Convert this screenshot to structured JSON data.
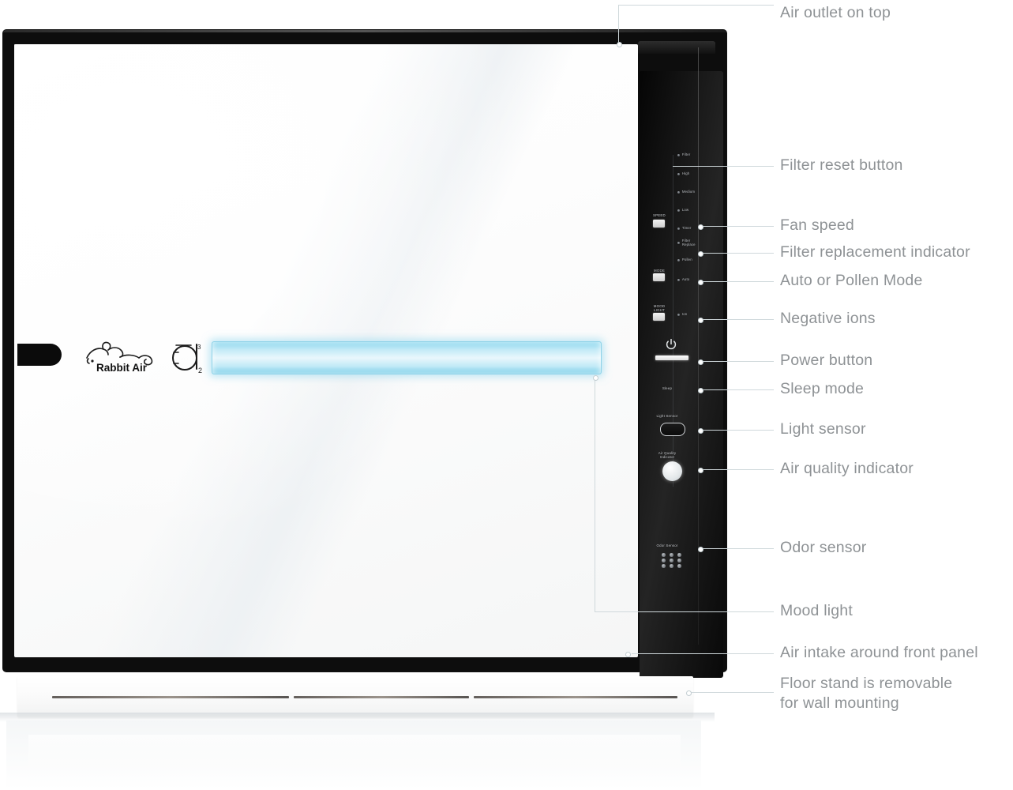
{
  "device": {
    "brand": "Rabbit Air",
    "model_logo": "A3",
    "front_panel_color": "#ffffff",
    "frame_color": "#0d0d0d",
    "mood_light_color": "#8ed2e8"
  },
  "control_panel": {
    "led_indicators": [
      {
        "name": "filter-reset-led",
        "label": "Filter"
      },
      {
        "name": "high-speed-led",
        "label": "High"
      },
      {
        "name": "medium-speed-led",
        "label": "Medium"
      },
      {
        "name": "low-speed-led",
        "label": "Low"
      },
      {
        "name": "timer-led",
        "label": "Timer"
      },
      {
        "name": "filter-replacement-led",
        "label": "Filter\nReplace"
      },
      {
        "name": "pollen-mode-led",
        "label": "Pollen"
      },
      {
        "name": "auto-mode-led",
        "label": "Auto"
      },
      {
        "name": "negative-ion-led",
        "label": "Ion"
      }
    ],
    "buttons": [
      {
        "name": "speed-button",
        "label": "SPEED"
      },
      {
        "name": "mode-button",
        "label": "MODE\nor\nReset"
      },
      {
        "name": "mood-light-button",
        "label": "MOOD\nLIGHT\nor\nION"
      }
    ],
    "power": {
      "label": "Power",
      "icon": "power-icon"
    },
    "sleep": {
      "label": "Sleep"
    },
    "light_sensor": {
      "label": "Light Sensor"
    },
    "air_quality": {
      "label": "Air Quality\nIndicator"
    },
    "odor_sensor": {
      "label": "Odor Sensor"
    }
  },
  "callouts": [
    {
      "id": "air-outlet",
      "label": "Air outlet on top"
    },
    {
      "id": "filter-reset",
      "label": "Filter reset button"
    },
    {
      "id": "fan-speed",
      "label": "Fan speed"
    },
    {
      "id": "filter-replacement",
      "label": "Filter replacement indicator"
    },
    {
      "id": "auto-pollen",
      "label": "Auto or Pollen Mode"
    },
    {
      "id": "negative-ions",
      "label": "Negative ions"
    },
    {
      "id": "power-button",
      "label": "Power button"
    },
    {
      "id": "sleep-mode",
      "label": "Sleep mode"
    },
    {
      "id": "light-sensor",
      "label": "Light sensor"
    },
    {
      "id": "air-quality",
      "label": "Air quality indicator"
    },
    {
      "id": "odor-sensor",
      "label": "Odor sensor"
    },
    {
      "id": "mood-light",
      "label": "Mood light"
    },
    {
      "id": "air-intake",
      "label": "Air intake around front panel"
    },
    {
      "id": "floor-stand",
      "label": "Floor stand is removable\nfor wall mounting"
    }
  ]
}
